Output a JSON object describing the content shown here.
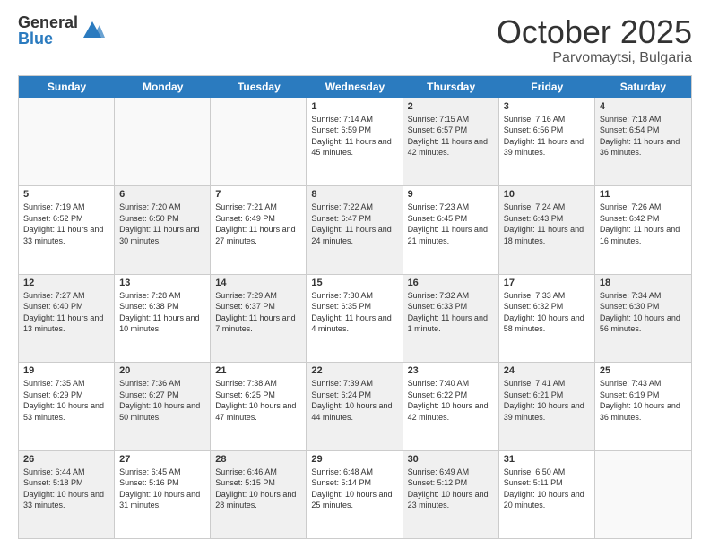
{
  "logo": {
    "general": "General",
    "blue": "Blue"
  },
  "header": {
    "month": "October 2025",
    "location": "Parvomaytsi, Bulgaria"
  },
  "weekdays": [
    "Sunday",
    "Monday",
    "Tuesday",
    "Wednesday",
    "Thursday",
    "Friday",
    "Saturday"
  ],
  "rows": [
    [
      {
        "day": "",
        "info": "",
        "shaded": false,
        "empty": true
      },
      {
        "day": "",
        "info": "",
        "shaded": false,
        "empty": true
      },
      {
        "day": "",
        "info": "",
        "shaded": false,
        "empty": true
      },
      {
        "day": "1",
        "info": "Sunrise: 7:14 AM\nSunset: 6:59 PM\nDaylight: 11 hours and 45 minutes.",
        "shaded": false,
        "empty": false
      },
      {
        "day": "2",
        "info": "Sunrise: 7:15 AM\nSunset: 6:57 PM\nDaylight: 11 hours and 42 minutes.",
        "shaded": true,
        "empty": false
      },
      {
        "day": "3",
        "info": "Sunrise: 7:16 AM\nSunset: 6:56 PM\nDaylight: 11 hours and 39 minutes.",
        "shaded": false,
        "empty": false
      },
      {
        "day": "4",
        "info": "Sunrise: 7:18 AM\nSunset: 6:54 PM\nDaylight: 11 hours and 36 minutes.",
        "shaded": true,
        "empty": false
      }
    ],
    [
      {
        "day": "5",
        "info": "Sunrise: 7:19 AM\nSunset: 6:52 PM\nDaylight: 11 hours and 33 minutes.",
        "shaded": false,
        "empty": false
      },
      {
        "day": "6",
        "info": "Sunrise: 7:20 AM\nSunset: 6:50 PM\nDaylight: 11 hours and 30 minutes.",
        "shaded": true,
        "empty": false
      },
      {
        "day": "7",
        "info": "Sunrise: 7:21 AM\nSunset: 6:49 PM\nDaylight: 11 hours and 27 minutes.",
        "shaded": false,
        "empty": false
      },
      {
        "day": "8",
        "info": "Sunrise: 7:22 AM\nSunset: 6:47 PM\nDaylight: 11 hours and 24 minutes.",
        "shaded": true,
        "empty": false
      },
      {
        "day": "9",
        "info": "Sunrise: 7:23 AM\nSunset: 6:45 PM\nDaylight: 11 hours and 21 minutes.",
        "shaded": false,
        "empty": false
      },
      {
        "day": "10",
        "info": "Sunrise: 7:24 AM\nSunset: 6:43 PM\nDaylight: 11 hours and 18 minutes.",
        "shaded": true,
        "empty": false
      },
      {
        "day": "11",
        "info": "Sunrise: 7:26 AM\nSunset: 6:42 PM\nDaylight: 11 hours and 16 minutes.",
        "shaded": false,
        "empty": false
      }
    ],
    [
      {
        "day": "12",
        "info": "Sunrise: 7:27 AM\nSunset: 6:40 PM\nDaylight: 11 hours and 13 minutes.",
        "shaded": true,
        "empty": false
      },
      {
        "day": "13",
        "info": "Sunrise: 7:28 AM\nSunset: 6:38 PM\nDaylight: 11 hours and 10 minutes.",
        "shaded": false,
        "empty": false
      },
      {
        "day": "14",
        "info": "Sunrise: 7:29 AM\nSunset: 6:37 PM\nDaylight: 11 hours and 7 minutes.",
        "shaded": true,
        "empty": false
      },
      {
        "day": "15",
        "info": "Sunrise: 7:30 AM\nSunset: 6:35 PM\nDaylight: 11 hours and 4 minutes.",
        "shaded": false,
        "empty": false
      },
      {
        "day": "16",
        "info": "Sunrise: 7:32 AM\nSunset: 6:33 PM\nDaylight: 11 hours and 1 minute.",
        "shaded": true,
        "empty": false
      },
      {
        "day": "17",
        "info": "Sunrise: 7:33 AM\nSunset: 6:32 PM\nDaylight: 10 hours and 58 minutes.",
        "shaded": false,
        "empty": false
      },
      {
        "day": "18",
        "info": "Sunrise: 7:34 AM\nSunset: 6:30 PM\nDaylight: 10 hours and 56 minutes.",
        "shaded": true,
        "empty": false
      }
    ],
    [
      {
        "day": "19",
        "info": "Sunrise: 7:35 AM\nSunset: 6:29 PM\nDaylight: 10 hours and 53 minutes.",
        "shaded": false,
        "empty": false
      },
      {
        "day": "20",
        "info": "Sunrise: 7:36 AM\nSunset: 6:27 PM\nDaylight: 10 hours and 50 minutes.",
        "shaded": true,
        "empty": false
      },
      {
        "day": "21",
        "info": "Sunrise: 7:38 AM\nSunset: 6:25 PM\nDaylight: 10 hours and 47 minutes.",
        "shaded": false,
        "empty": false
      },
      {
        "day": "22",
        "info": "Sunrise: 7:39 AM\nSunset: 6:24 PM\nDaylight: 10 hours and 44 minutes.",
        "shaded": true,
        "empty": false
      },
      {
        "day": "23",
        "info": "Sunrise: 7:40 AM\nSunset: 6:22 PM\nDaylight: 10 hours and 42 minutes.",
        "shaded": false,
        "empty": false
      },
      {
        "day": "24",
        "info": "Sunrise: 7:41 AM\nSunset: 6:21 PM\nDaylight: 10 hours and 39 minutes.",
        "shaded": true,
        "empty": false
      },
      {
        "day": "25",
        "info": "Sunrise: 7:43 AM\nSunset: 6:19 PM\nDaylight: 10 hours and 36 minutes.",
        "shaded": false,
        "empty": false
      }
    ],
    [
      {
        "day": "26",
        "info": "Sunrise: 6:44 AM\nSunset: 5:18 PM\nDaylight: 10 hours and 33 minutes.",
        "shaded": true,
        "empty": false
      },
      {
        "day": "27",
        "info": "Sunrise: 6:45 AM\nSunset: 5:16 PM\nDaylight: 10 hours and 31 minutes.",
        "shaded": false,
        "empty": false
      },
      {
        "day": "28",
        "info": "Sunrise: 6:46 AM\nSunset: 5:15 PM\nDaylight: 10 hours and 28 minutes.",
        "shaded": true,
        "empty": false
      },
      {
        "day": "29",
        "info": "Sunrise: 6:48 AM\nSunset: 5:14 PM\nDaylight: 10 hours and 25 minutes.",
        "shaded": false,
        "empty": false
      },
      {
        "day": "30",
        "info": "Sunrise: 6:49 AM\nSunset: 5:12 PM\nDaylight: 10 hours and 23 minutes.",
        "shaded": true,
        "empty": false
      },
      {
        "day": "31",
        "info": "Sunrise: 6:50 AM\nSunset: 5:11 PM\nDaylight: 10 hours and 20 minutes.",
        "shaded": false,
        "empty": false
      },
      {
        "day": "",
        "info": "",
        "shaded": false,
        "empty": true
      }
    ]
  ]
}
